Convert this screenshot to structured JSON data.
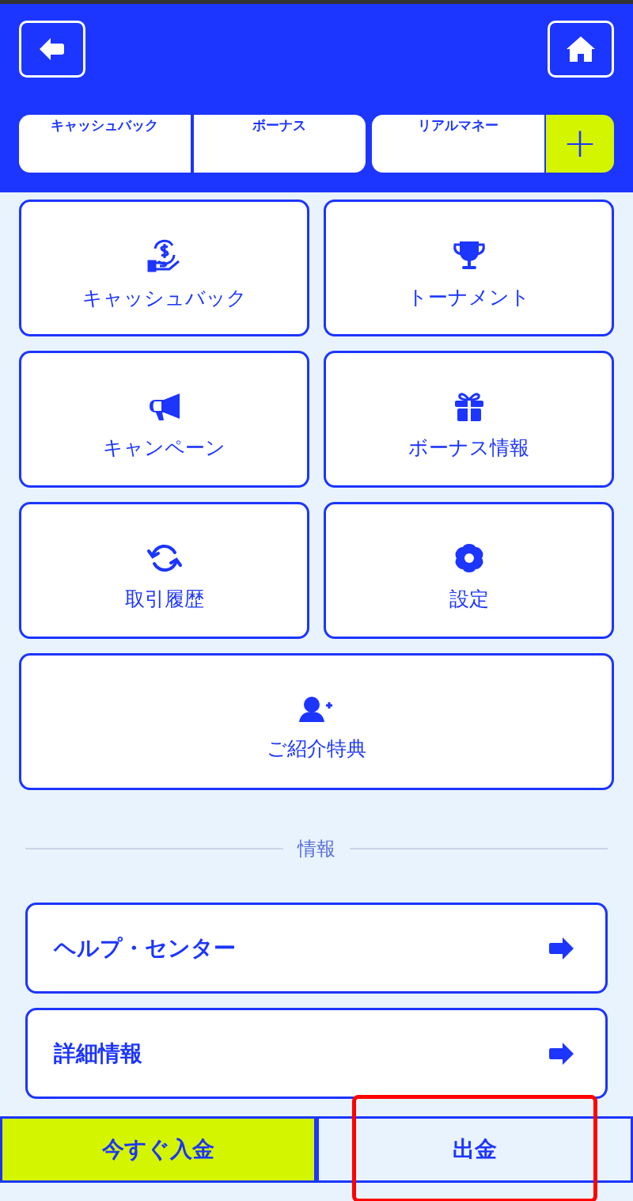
{
  "balances": [
    {
      "label": "キャッシュバック"
    },
    {
      "label": "ボーナス"
    },
    {
      "label": "リアルマネー"
    }
  ],
  "add_button": {
    "label": "+"
  },
  "tiles": [
    {
      "label": "キャッシュバック"
    },
    {
      "label": "トーナメント"
    },
    {
      "label": "キャンペーン"
    },
    {
      "label": "ボーナス情報"
    },
    {
      "label": "取引履歴"
    },
    {
      "label": "設定"
    },
    {
      "label": "ご紹介特典"
    }
  ],
  "section_title": "情報",
  "links": [
    {
      "label": "ヘルプ・センター"
    },
    {
      "label": "詳細情報"
    }
  ],
  "footer": [
    {
      "label": "今すぐ入金",
      "kind": "primary",
      "highlighted": false
    },
    {
      "label": "出金",
      "kind": "secondary",
      "highlighted": true
    }
  ]
}
